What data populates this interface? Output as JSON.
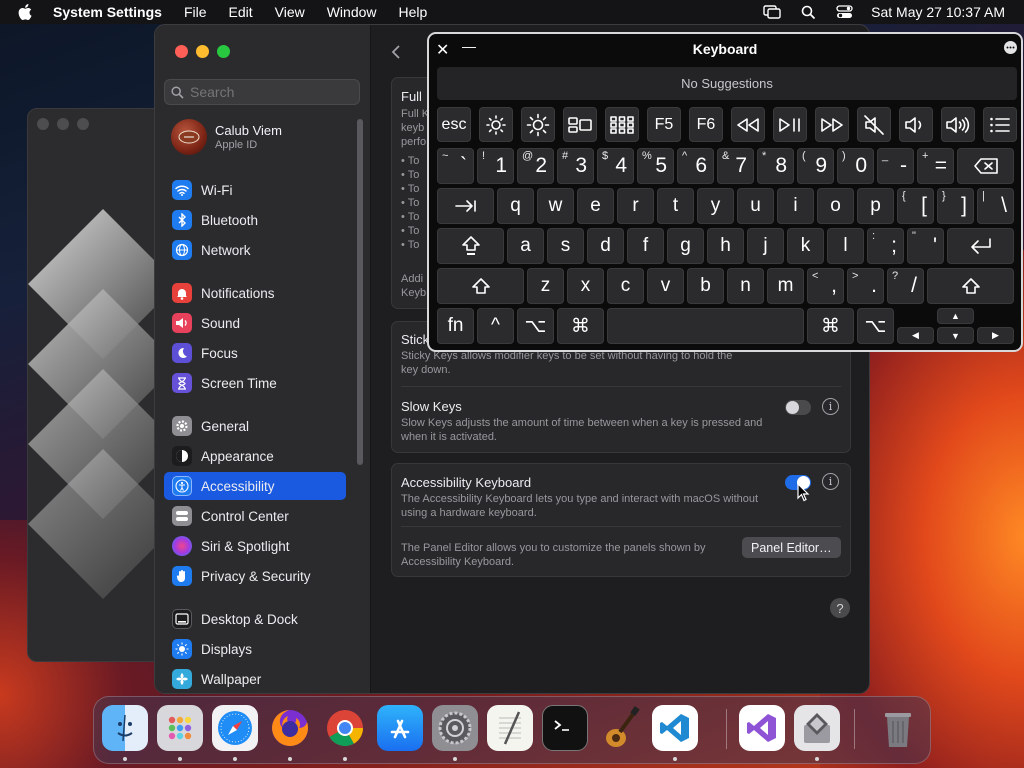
{
  "menubar": {
    "app_name": "System Settings",
    "menus": [
      "File",
      "Edit",
      "View",
      "Window",
      "Help"
    ],
    "clock": "Sat May 27  10:37 AM"
  },
  "sidebar": {
    "search_placeholder": "Search",
    "profile": {
      "name": "Calub Viem",
      "subtitle": "Apple ID"
    },
    "items": [
      {
        "label": "Wi-Fi",
        "icon": "wifi-icon",
        "color": "#1f7bf0"
      },
      {
        "label": "Bluetooth",
        "icon": "bluetooth-icon",
        "color": "#1f7bf0"
      },
      {
        "label": "Network",
        "icon": "globe-icon",
        "color": "#1f7bf0"
      },
      {
        "label": "Notifications",
        "icon": "bell-icon",
        "color": "#e8413b"
      },
      {
        "label": "Sound",
        "icon": "speaker-icon",
        "color": "#e8415b"
      },
      {
        "label": "Focus",
        "icon": "moon-icon",
        "color": "#5d4fd6"
      },
      {
        "label": "Screen Time",
        "icon": "hourglass-icon",
        "color": "#6552d8"
      },
      {
        "label": "General",
        "icon": "gear-icon",
        "color": "#8e8e93"
      },
      {
        "label": "Appearance",
        "icon": "appearance-icon",
        "color": "#1c1c1e"
      },
      {
        "label": "Accessibility",
        "icon": "accessibility-icon",
        "color": "#1f7bf0",
        "active": true
      },
      {
        "label": "Control Center",
        "icon": "control-center-icon",
        "color": "#8e8e93"
      },
      {
        "label": "Siri & Spotlight",
        "icon": "siri-icon",
        "color": "#b43ad1"
      },
      {
        "label": "Privacy & Security",
        "icon": "hand-icon",
        "color": "#1f7bf0"
      },
      {
        "label": "Desktop & Dock",
        "icon": "dock-icon",
        "color": "#1c1c1e"
      },
      {
        "label": "Displays",
        "icon": "sun-icon",
        "color": "#1f7bf0"
      },
      {
        "label": "Wallpaper",
        "icon": "wallpaper-icon",
        "color": "#34aadc"
      }
    ]
  },
  "content": {
    "full_title": "Full",
    "full_lines": [
      "Full K",
      "keyb",
      "perfo"
    ],
    "bullets": [
      "• To",
      "• To",
      "• To",
      "• To",
      "• To",
      "• To",
      "• To"
    ],
    "addi_lines": [
      "Addi",
      "Keyb"
    ],
    "sticky_title": "Stick",
    "sticky_desc": "Sticky Keys allows modifier keys to be set without having to hold the",
    "sticky_desc2": "key down.",
    "slow_title": "Slow Keys",
    "slow_desc": "Slow Keys adjusts the amount of time between when a key is pressed and when it is activated.",
    "slow_on": false,
    "ak_title": "Accessibility Keyboard",
    "ak_desc": "The Accessibility Keyboard lets you type and interact with macOS without using a hardware keyboard.",
    "ak_on": true,
    "panel_desc": "The Panel Editor allows you to customize the panels shown by Accessibility Keyboard.",
    "panel_button": "Panel Editor…",
    "info_glyph": "i",
    "help_glyph": "?"
  },
  "keyboard": {
    "title": "Keyboard",
    "close": "✕",
    "minimize": "—",
    "suggestions": "No Suggestions",
    "function_row": [
      {
        "label": "esc"
      },
      {
        "icon": "brightness-down-icon"
      },
      {
        "icon": "brightness-up-icon"
      },
      {
        "icon": "mission-control-icon"
      },
      {
        "icon": "launchpad-icon"
      },
      {
        "label": "F5"
      },
      {
        "label": "F6"
      },
      {
        "icon": "rewind-icon"
      },
      {
        "icon": "play-pause-icon"
      },
      {
        "icon": "fast-forward-icon"
      },
      {
        "icon": "mute-icon"
      },
      {
        "icon": "volume-down-icon"
      },
      {
        "icon": "volume-up-icon"
      },
      {
        "icon": "menu-list-icon"
      }
    ],
    "number_row": [
      {
        "sec": "~",
        "pri": "`"
      },
      {
        "sec": "!",
        "pri": "1"
      },
      {
        "sec": "@",
        "pri": "2"
      },
      {
        "sec": "#",
        "pri": "3"
      },
      {
        "sec": "$",
        "pri": "4"
      },
      {
        "sec": "%",
        "pri": "5"
      },
      {
        "sec": "^",
        "pri": "6"
      },
      {
        "sec": "&",
        "pri": "7"
      },
      {
        "sec": "*",
        "pri": "8"
      },
      {
        "sec": "(",
        "pri": "9"
      },
      {
        "sec": ")",
        "pri": "0"
      },
      {
        "sec": "_",
        "pri": "-"
      },
      {
        "sec": "+",
        "pri": "="
      }
    ],
    "row_q": [
      "q",
      "w",
      "e",
      "r",
      "t",
      "y",
      "u",
      "i",
      "o",
      "p"
    ],
    "row_q_extra": [
      {
        "sec": "{",
        "pri": "["
      },
      {
        "sec": "}",
        "pri": "]"
      },
      {
        "sec": "|",
        "pri": "\\"
      }
    ],
    "row_a": [
      "a",
      "s",
      "d",
      "f",
      "g",
      "h",
      "j",
      "k",
      "l"
    ],
    "row_a_extra": [
      {
        "sec": ":",
        "pri": ";"
      },
      {
        "sec": "\"",
        "pri": "'"
      }
    ],
    "row_z": [
      "z",
      "x",
      "c",
      "v",
      "b",
      "n",
      "m"
    ],
    "row_z_extra": [
      {
        "sec": "<",
        "pri": ","
      },
      {
        "sec": ">",
        "pri": "."
      },
      {
        "sec": "?",
        "pri": "/"
      }
    ],
    "bottom": {
      "fn": "fn",
      "control": "^",
      "option": "⌥",
      "command": "⌘"
    },
    "arrows": {
      "up": "▲",
      "down": "▼",
      "left": "◀",
      "right": "▶"
    }
  },
  "dock": {
    "apps": [
      "Finder",
      "Launchpad",
      "Safari",
      "Firefox",
      "Chrome",
      "App Store",
      "System Settings",
      "TextEdit",
      "Terminal",
      "GarageBand",
      "VS Code",
      "Visual Studio",
      "Boot Camp",
      "Trash"
    ]
  }
}
